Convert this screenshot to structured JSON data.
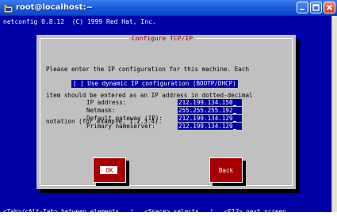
{
  "window": {
    "title": "root@localhost:~",
    "colors": {
      "terminal_bg": "#0000a8",
      "dialog_bg": "#c0c0c0",
      "button_bg": "#a80000",
      "title_text": "#a00000"
    }
  },
  "terminal": {
    "header": "netconfig 0.8.12  (C) 1999 Red Hat, Inc."
  },
  "dialog": {
    "title": "Configure TCP/IP",
    "intro_lines": [
      "Please enter the IP configuration for this machine. Each",
      "item should be entered as an IP address in dotted-decimal",
      "notation (for example, 1.2.3.4)."
    ],
    "dhcp_checkbox": {
      "checked": false,
      "text": "[ ] Use dynamic IP configuration (BOOTP/DHCP)"
    },
    "fields": {
      "ip_address": {
        "label": "IP address:",
        "value": "212.199.134.150"
      },
      "netmask": {
        "label": "Netmask:",
        "value": "255.255.255.192"
      },
      "gateway": {
        "label": "Default gateway (IP):",
        "value": "212.199.134.129"
      },
      "nameserver": {
        "label": "Primary nameserver:",
        "value": "212.199.134.129"
      }
    },
    "buttons": {
      "ok": "OK",
      "back": "Back"
    }
  },
  "statusbar": {
    "text": "<Tab>/<Alt-Tab> between elements   |   <Space> selects   |   <F12> next screen"
  }
}
